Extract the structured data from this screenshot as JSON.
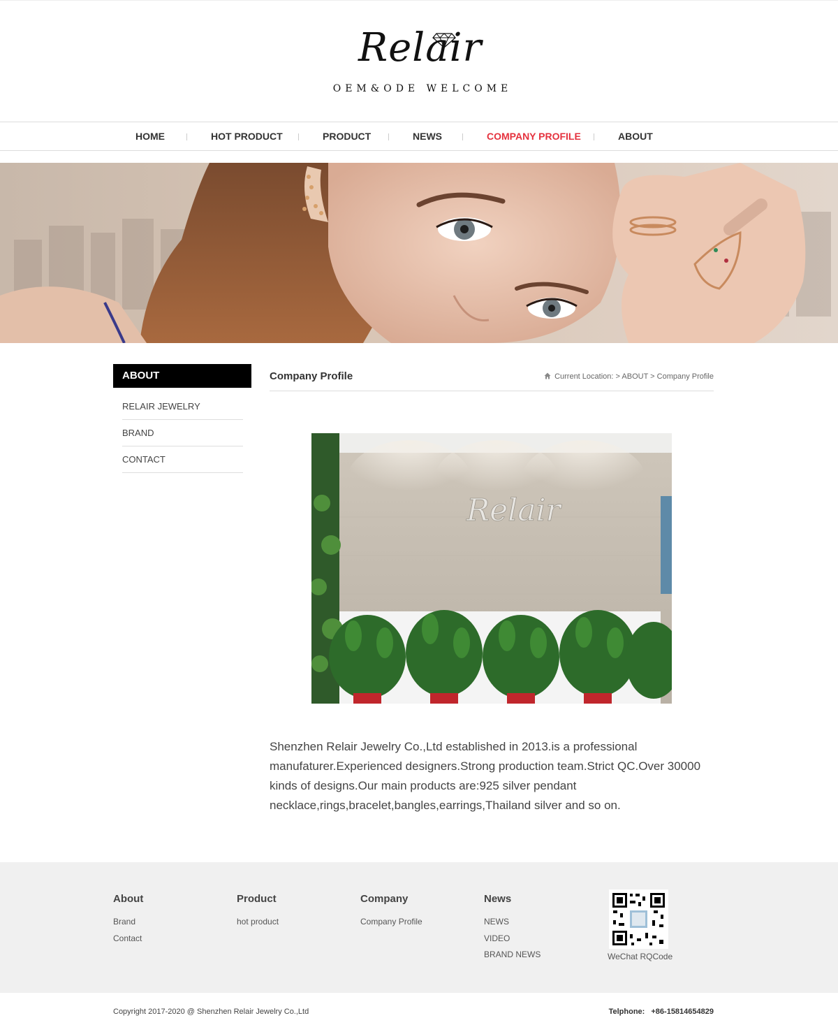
{
  "header": {
    "logo_text": "Relair",
    "tagline": "OEM&ODE WELCOME"
  },
  "nav": {
    "items": [
      {
        "label": "HOME"
      },
      {
        "label": "HOT PRODUCT"
      },
      {
        "label": "PRODUCT"
      },
      {
        "label": "NEWS"
      },
      {
        "label": "COMPANY PROFILE",
        "active": true
      },
      {
        "label": "ABOUT"
      }
    ]
  },
  "sidebar": {
    "heading": "ABOUT",
    "items": [
      {
        "label": "RELAIR JEWELRY"
      },
      {
        "label": "BRAND"
      },
      {
        "label": "CONTACT"
      }
    ]
  },
  "content": {
    "title": "Company Profile",
    "breadcrumb": {
      "prefix": "Current Location:",
      "sep": ">",
      "items": [
        "ABOUT",
        "Company Profile"
      ]
    },
    "photo_sign_text": "Relair",
    "description": "Shenzhen Relair Jewelry Co.,Ltd established in 2013.is a professional manufaturer.Experienced designers.Strong production team.Strict QC.Over 30000 kinds of designs.Our main products are:925 silver pendant necklace,rings,bracelet,bangles,earrings,Thailand silver and so on."
  },
  "footer": {
    "columns": [
      {
        "heading": "About",
        "links": [
          "Brand",
          "Contact"
        ]
      },
      {
        "heading": "Product",
        "links": [
          "hot product"
        ]
      },
      {
        "heading": "Company",
        "links": [
          "Company Profile"
        ]
      },
      {
        "heading": "News",
        "links": [
          "NEWS",
          "VIDEO",
          "BRAND NEWS"
        ]
      }
    ],
    "qr_label": "WeChat RQCode",
    "copyright": "Copyright 2017-2020 @ Shenzhen Relair Jewelry Co.,Ltd",
    "phone_label": "Telphone:",
    "phone_value": "+86-15814654829"
  },
  "colors": {
    "accent": "#e5323e",
    "sidebar_heading_bg": "#000000",
    "footer_bg": "#f0f0f0"
  },
  "icons": {
    "logo_gem": "diamond-icon",
    "breadcrumb_home": "home-icon"
  }
}
